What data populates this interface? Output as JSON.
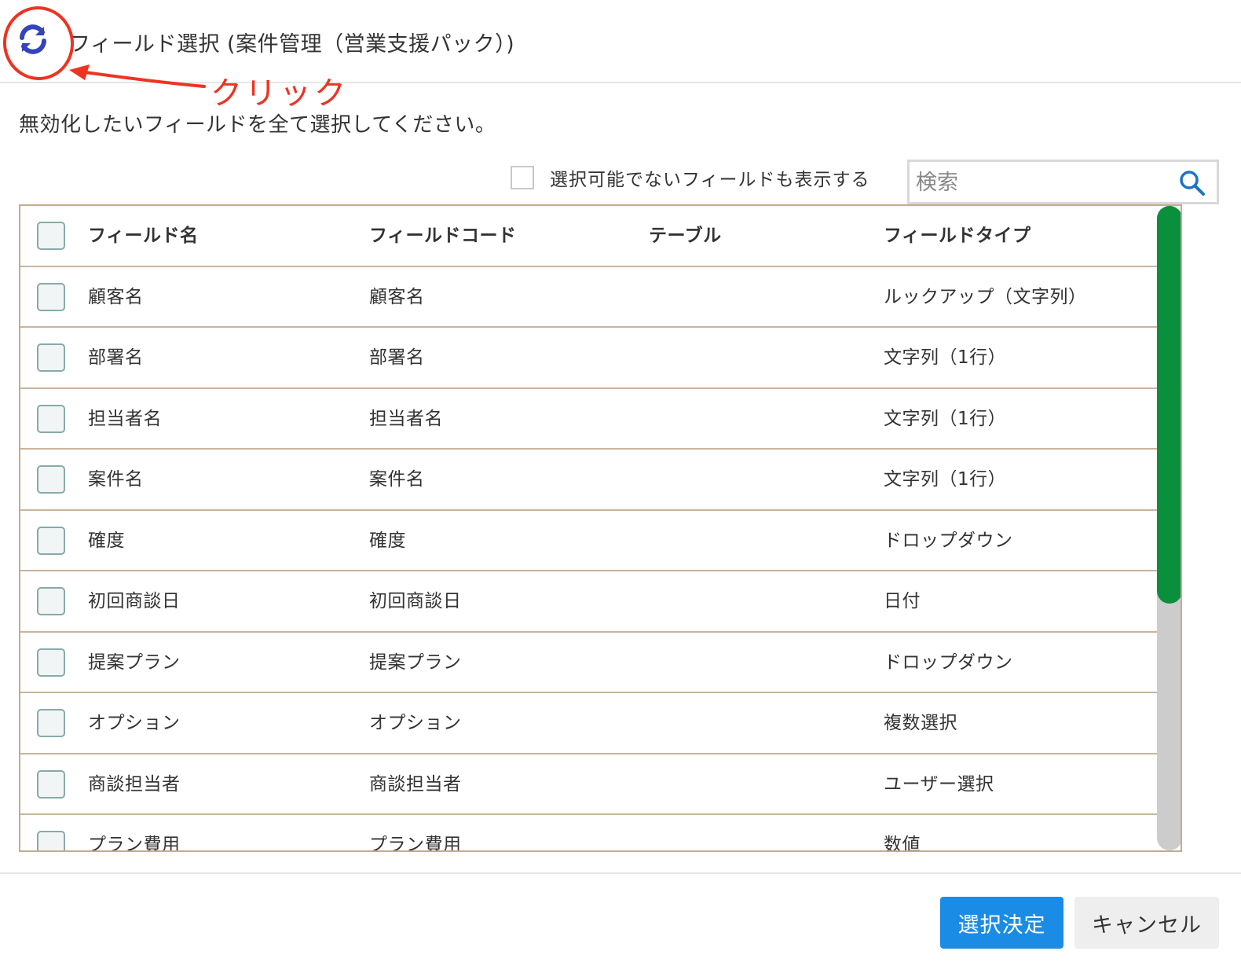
{
  "header": {
    "title": "フィールド選択 (案件管理（営業支援パック）)",
    "refresh_icon": "refresh-icon"
  },
  "annotation": {
    "text": "クリック",
    "color": "#ee3322"
  },
  "instruction": "無効化したいフィールドを全て選択してください。",
  "filter": {
    "show_unselectable_label": "選択可能でないフィールドも表示する",
    "show_unselectable_checked": false
  },
  "search": {
    "placeholder": "検索",
    "value": "",
    "icon": "search-icon"
  },
  "table": {
    "columns": [
      "フィールド名",
      "フィールドコード",
      "テーブル",
      "フィールドタイプ"
    ],
    "rows": [
      {
        "name": "顧客名",
        "code": "顧客名",
        "table": "",
        "type": "ルックアップ（文字列）"
      },
      {
        "name": "部署名",
        "code": "部署名",
        "table": "",
        "type": "文字列（1行）"
      },
      {
        "name": "担当者名",
        "code": "担当者名",
        "table": "",
        "type": "文字列（1行）"
      },
      {
        "name": "案件名",
        "code": "案件名",
        "table": "",
        "type": "文字列（1行）"
      },
      {
        "name": "確度",
        "code": "確度",
        "table": "",
        "type": "ドロップダウン"
      },
      {
        "name": "初回商談日",
        "code": "初回商談日",
        "table": "",
        "type": "日付"
      },
      {
        "name": "提案プラン",
        "code": "提案プラン",
        "table": "",
        "type": "ドロップダウン"
      },
      {
        "name": "オプション",
        "code": "オプション",
        "table": "",
        "type": "複数選択"
      },
      {
        "name": "商談担当者",
        "code": "商談担当者",
        "table": "",
        "type": "ユーザー選択"
      },
      {
        "name": "プラン費用",
        "code": "プラン費用",
        "table": "",
        "type": "数値"
      }
    ]
  },
  "colors": {
    "primary_button": "#1a8ce6",
    "scroll_thumb": "#0a8f3c",
    "table_border": "#c4ab90",
    "refresh_icon": "#3344bb"
  },
  "buttons": {
    "ok_label": "選択決定",
    "cancel_label": "キャンセル"
  }
}
